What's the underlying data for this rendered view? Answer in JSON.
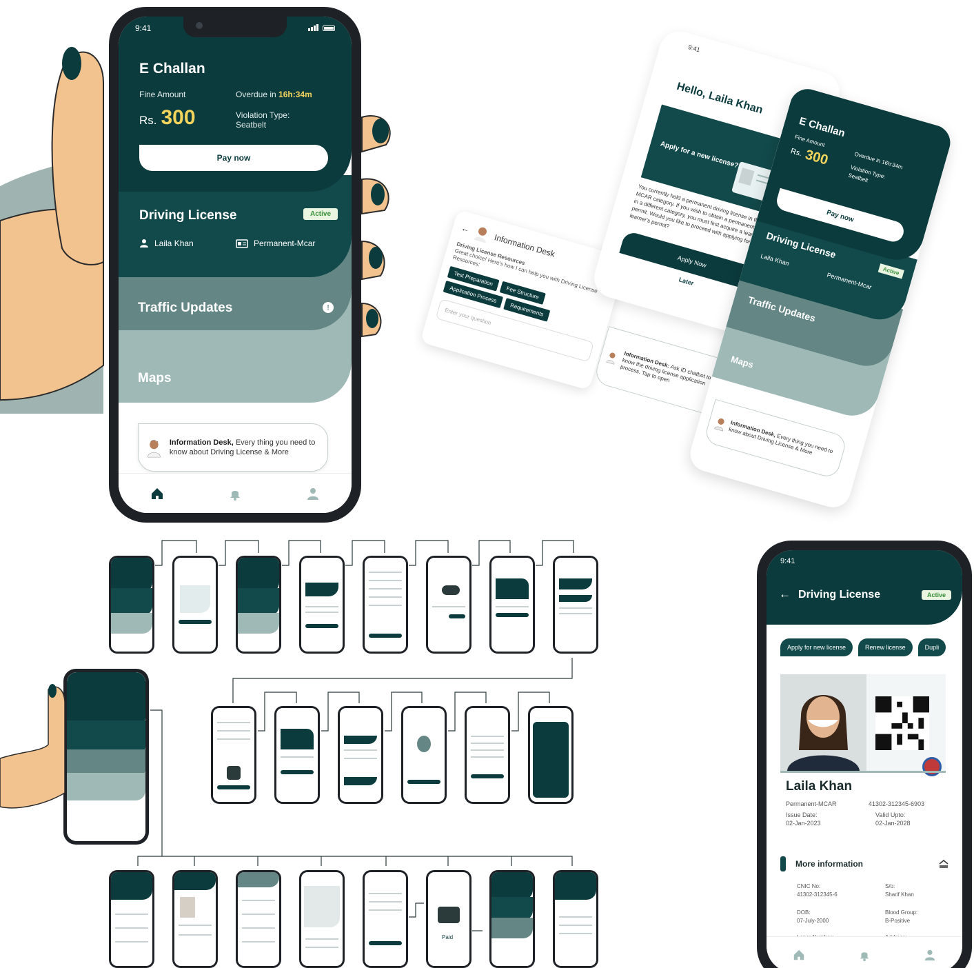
{
  "main_phone": {
    "status_time": "9:41",
    "challan": {
      "title": "E Challan",
      "fine_label": "Fine Amount",
      "overdue_prefix": "Overdue in",
      "overdue_time": "16h:34m",
      "currency": "Rs.",
      "amount": "300",
      "violation_label": "Violation Type:",
      "violation_value": "Seatbelt",
      "pay_button": "Pay now"
    },
    "license": {
      "title": "Driving License",
      "status": "Active",
      "holder": "Laila Khan",
      "category": "Permanent-Mcar"
    },
    "traffic": {
      "title": "Traffic Updates",
      "badge": "!"
    },
    "maps": {
      "title": "Maps"
    },
    "info_desk": {
      "title": "Information Desk,",
      "text": "Every thing you need to know about Driving License & More"
    },
    "tabs": [
      "home-icon",
      "bell-icon",
      "profile-icon"
    ]
  },
  "chat_mockup": {
    "title": "Information Desk",
    "subtitle": "Driving License Resources",
    "message": "Great choice! Here's how I can help you with Driving License Resources:",
    "chips": [
      "Test Preparation",
      "Fee Structure",
      "Application Process",
      "Requirements"
    ],
    "input_placeholder": "Enter your question"
  },
  "hello_mockup": {
    "status_time": "9:41",
    "greeting": "Hello, Laila Khan",
    "card_text": "Apply for a new license?",
    "body": "You currently hold a permanent driving license in the MCAR category. If you wish to obtain a permanent license in a different category, you must first acquire a learner's permit. Would you like to proceed with applying for a learner's permit?",
    "apply_button": "Apply Now",
    "later_button": "Later"
  },
  "chat_bubble": {
    "title": "Information Desk:",
    "text": "Ask ID chatbot to know the driving license application process. Tap to open"
  },
  "tilted_phone": {
    "challan_title": "E Challan",
    "fine_label": "Fine Amount",
    "overdue": "Overdue in 16h:34m",
    "currency": "Rs.",
    "amount": "300",
    "violation_label": "Violation Type:",
    "violation_value": "Seatbelt",
    "pay_button": "Pay now",
    "license_title": "Driving License",
    "license_status": "Active",
    "holder": "Laila Khan",
    "category": "Permanent-Mcar",
    "traffic": "Traffic Updates",
    "maps": "Maps",
    "info_title": "Information Desk,",
    "info_text": "Every thing you need to know about Driving License & More"
  },
  "flow_mini": {
    "paid_label": "Paid"
  },
  "license_phone": {
    "status_time": "9:41",
    "title": "Driving License",
    "status": "Active",
    "buttons": [
      "Apply for new license",
      "Renew license",
      "Dupli"
    ],
    "name": "Laila Khan",
    "category": "Permanent-MCAR",
    "cnic": "41302-312345-6903",
    "issue_label": "Issue Date:",
    "issue_date": "02-Jan-2023",
    "valid_label": "Valid Upto:",
    "valid_date": "02-Jan-2028",
    "more_info": "More information",
    "fields": {
      "cnic_label": "CNIC No:",
      "cnic_value": "41302-312345-6",
      "father_label": "S/o:",
      "father_value": "Sharif Khan",
      "dob_label": "DOB:",
      "dob_value": "07-July-2000",
      "blood_label": "Blood Group:",
      "blood_value": "B-Positive",
      "learner_label": "Laner Number:",
      "address_label": "Address:"
    }
  },
  "colors": {
    "dark_teal": "#0b3b3d",
    "teal": "#12494a",
    "mid_teal": "#648785",
    "light_teal": "#9fb9b7",
    "accent_yellow": "#f2d45c",
    "active_green": "#3a8f3a"
  }
}
